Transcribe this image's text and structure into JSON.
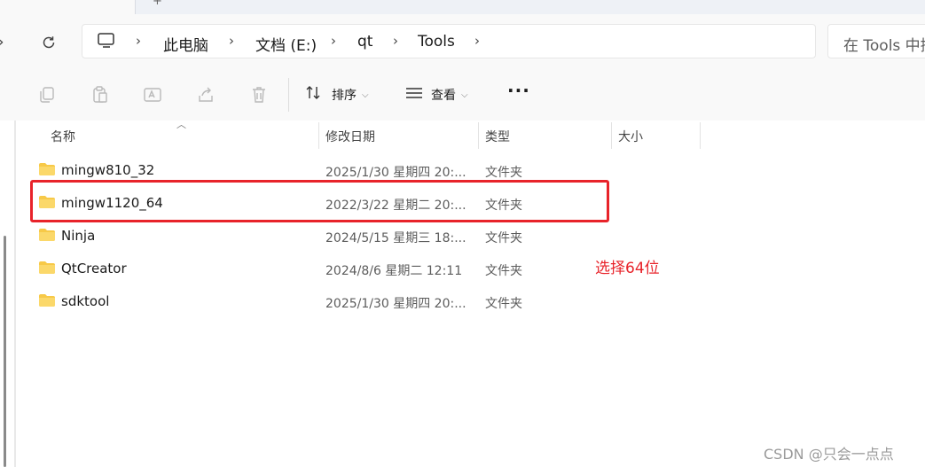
{
  "address_bar": {
    "breadcrumb": [
      "此电脑",
      "文档 (E:)",
      "qt",
      "Tools"
    ],
    "search_placeholder": "在 Tools 中搜"
  },
  "toolbar": {
    "sort_label": "排序",
    "view_label": "查看",
    "more_label": "···",
    "icons": [
      "copy-icon",
      "paste-icon",
      "rename-icon",
      "share-icon",
      "delete-icon",
      "sort-icon",
      "view-icon"
    ]
  },
  "columns": {
    "name": "名称",
    "modified": "修改日期",
    "type": "类型",
    "size": "大小"
  },
  "files": [
    {
      "name": "mingw810_32",
      "modified": "2025/1/30 星期四 20:...",
      "type": "文件夹"
    },
    {
      "name": "mingw1120_64",
      "modified": "2022/3/22 星期二 20:...",
      "type": "文件夹"
    },
    {
      "name": "Ninja",
      "modified": "2024/5/15 星期三 18:...",
      "type": "文件夹"
    },
    {
      "name": "QtCreator",
      "modified": "2024/8/6 星期二 12:11",
      "type": "文件夹"
    },
    {
      "name": "sdktool",
      "modified": "2025/1/30 星期四 20:...",
      "type": "文件夹"
    }
  ],
  "annotation": "选择64位",
  "watermark": "CSDN @只会一点点",
  "colors": {
    "annotation_red": "#e8232a",
    "folder_yellow": "#f7c948"
  }
}
